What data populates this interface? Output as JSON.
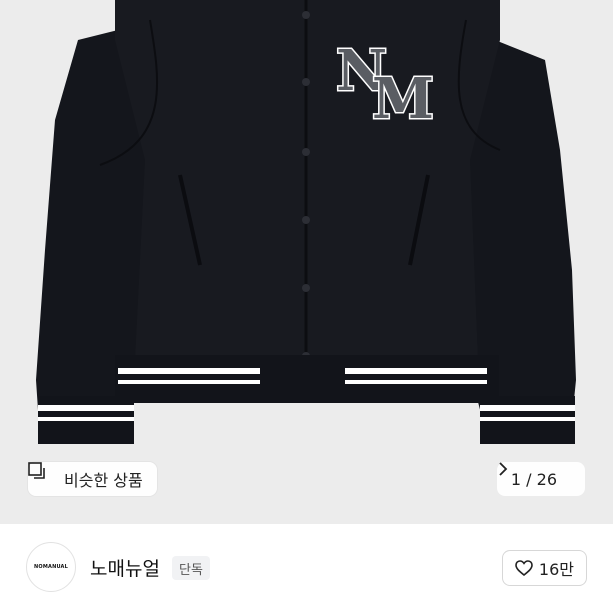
{
  "gallery": {
    "patch_letters": [
      "N",
      "M"
    ],
    "similar_label": "비슷한 상품",
    "counter": "1 / 26",
    "similar_icon": "similar-items-icon",
    "next_icon": "chevron-right-icon"
  },
  "seller": {
    "logo_text": "NOMANUAL",
    "name": "노매뉴얼",
    "badge": "단독"
  },
  "like": {
    "icon": "heart-outline-icon",
    "count": "16만"
  },
  "colors": {
    "background": "#ececec",
    "jacket": "#14161c",
    "patch": "#5a5d63",
    "stripe": "#ffffff"
  }
}
